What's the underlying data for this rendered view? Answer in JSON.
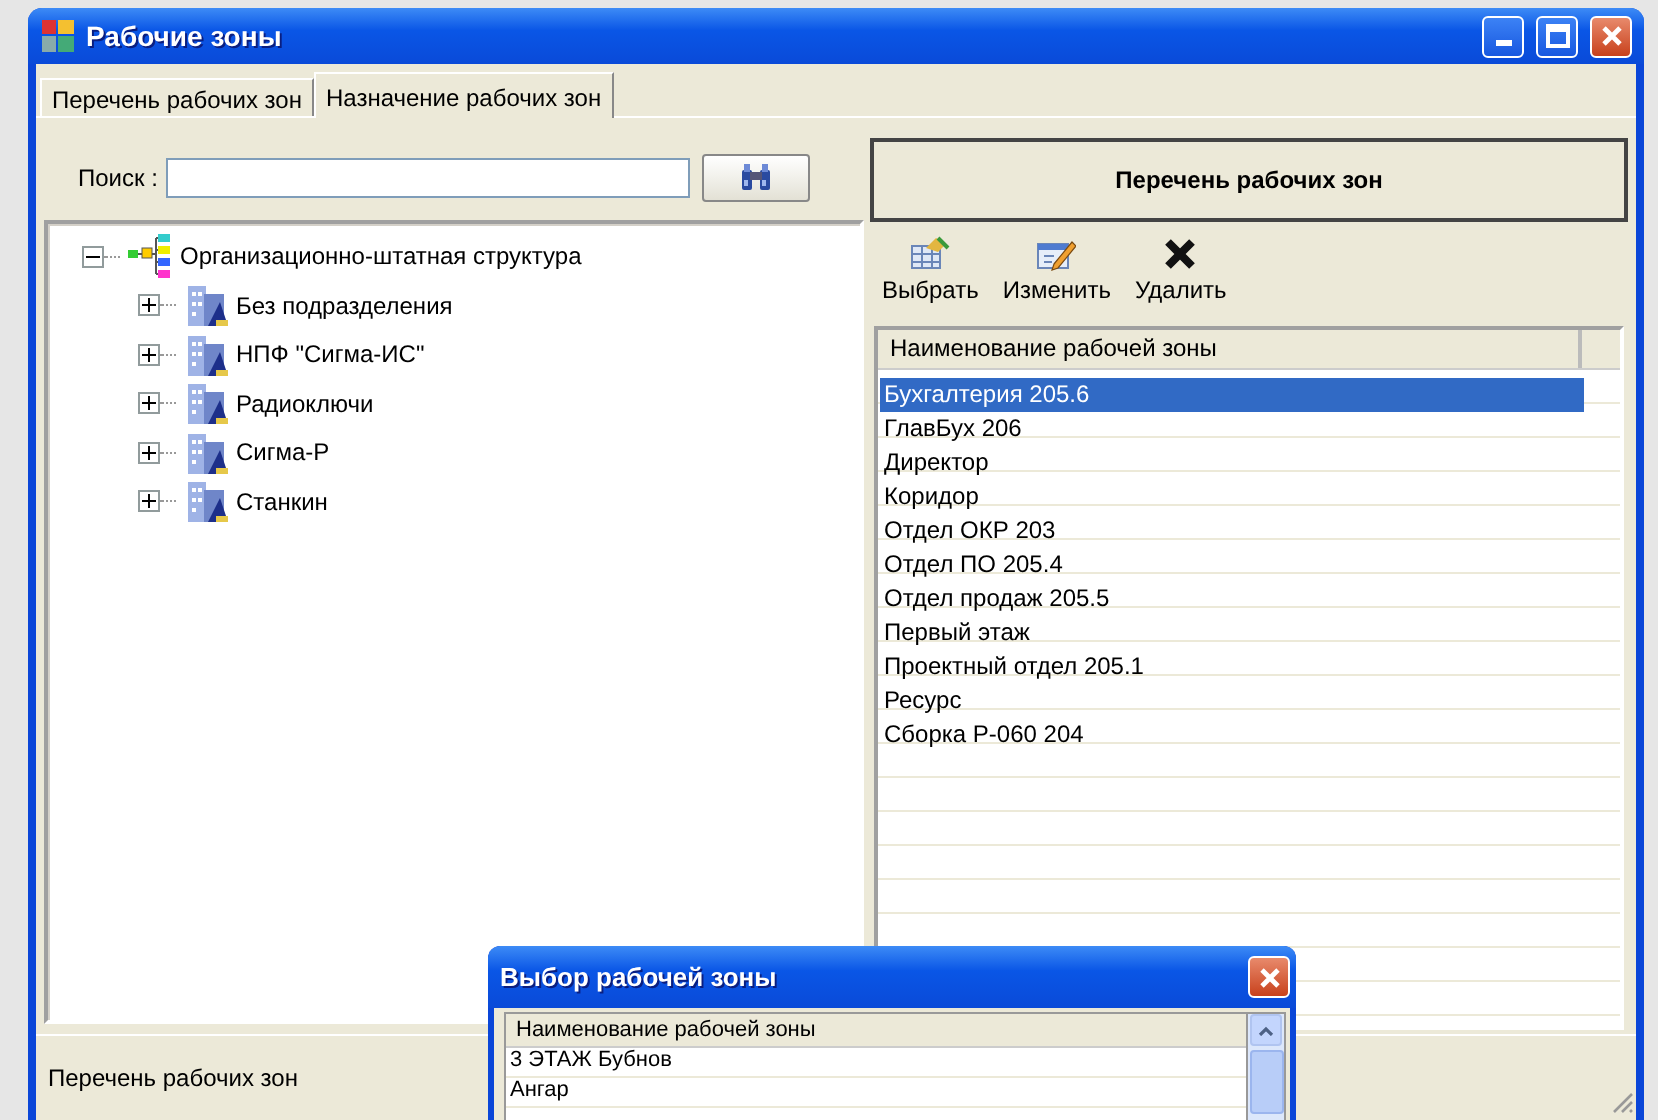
{
  "window": {
    "title": "Рабочие зоны"
  },
  "tabs": [
    {
      "label": "Перечень рабочих зон",
      "selected": false
    },
    {
      "label": "Назначение рабочих зон",
      "selected": true
    }
  ],
  "search": {
    "label": "Поиск :"
  },
  "tree": {
    "label": "Организационно-штатная структура",
    "expanded": true,
    "children": [
      {
        "label": "Без подразделения",
        "expanded": false
      },
      {
        "label": "НПФ \"Сигма-ИС\"",
        "expanded": false
      },
      {
        "label": "Радиоключи",
        "expanded": false
      },
      {
        "label": "Сигма-Р",
        "expanded": false
      },
      {
        "label": "Станкин",
        "expanded": false
      }
    ]
  },
  "zone_panel": {
    "title": "Перечень рабочих зон",
    "toolbar": [
      {
        "kind": "select",
        "label": "Выбрать"
      },
      {
        "kind": "edit",
        "label": "Изменить"
      },
      {
        "kind": "delete",
        "label": "Удалить"
      }
    ],
    "table": {
      "columns": [
        "Наименование рабочей зоны"
      ],
      "rows": [
        {
          "name": "Бухгалтерия 205.6",
          "selected": true
        },
        {
          "name": "ГлавБух 206",
          "selected": false
        },
        {
          "name": "Директор",
          "selected": false
        },
        {
          "name": "Коридор",
          "selected": false
        },
        {
          "name": "Отдел ОКР 203",
          "selected": false
        },
        {
          "name": "Отдел ПО 205.4",
          "selected": false
        },
        {
          "name": "Отдел продаж 205.5",
          "selected": false
        },
        {
          "name": "Первый этаж",
          "selected": false
        },
        {
          "name": "Проектный отдел 205.1",
          "selected": false
        },
        {
          "name": "Ресурс",
          "selected": false
        },
        {
          "name": "Сборка Р-060 204",
          "selected": false
        }
      ]
    }
  },
  "status_bar": "Перечень рабочих зон",
  "dialog": {
    "title": "Выбор рабочей зоны",
    "table": {
      "columns": [
        "Наименование рабочей зоны"
      ],
      "rows": [
        "3  ЭТАЖ Бубнов",
        "Ангар"
      ]
    }
  }
}
